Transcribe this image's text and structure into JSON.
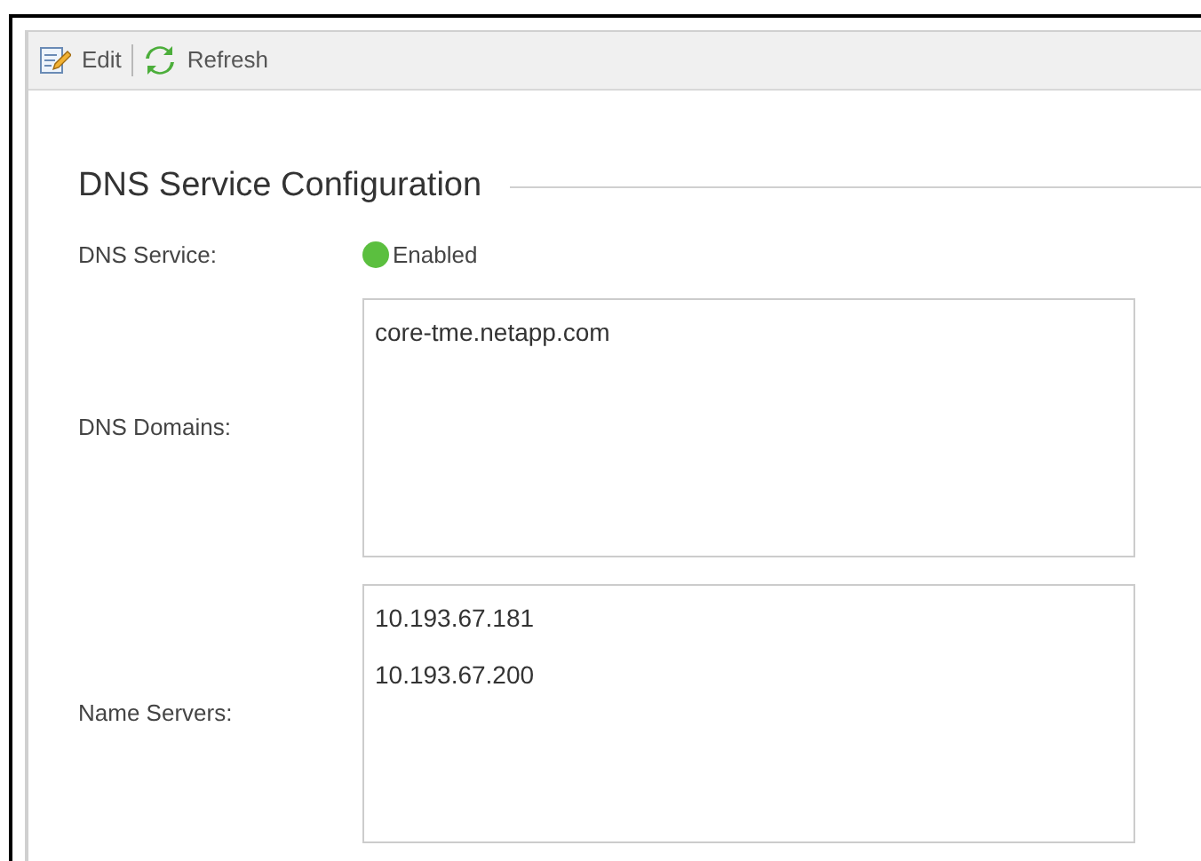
{
  "toolbar": [
    {
      "kind": "edit",
      "label": "Edit"
    },
    {
      "kind": "refresh",
      "label": "Refresh"
    }
  ],
  "section": {
    "title": "DNS Service Configuration"
  },
  "fields": [
    {
      "kind": "status",
      "label": "DNS Service:",
      "value": "Enabled",
      "enabled": true
    },
    {
      "kind": "list",
      "label": "DNS Domains:",
      "lines": [
        "core-tme.netapp.com"
      ]
    },
    {
      "kind": "list",
      "label": "Name Servers:",
      "lines": [
        "10.193.67.181",
        "10.193.67.200"
      ]
    }
  ]
}
